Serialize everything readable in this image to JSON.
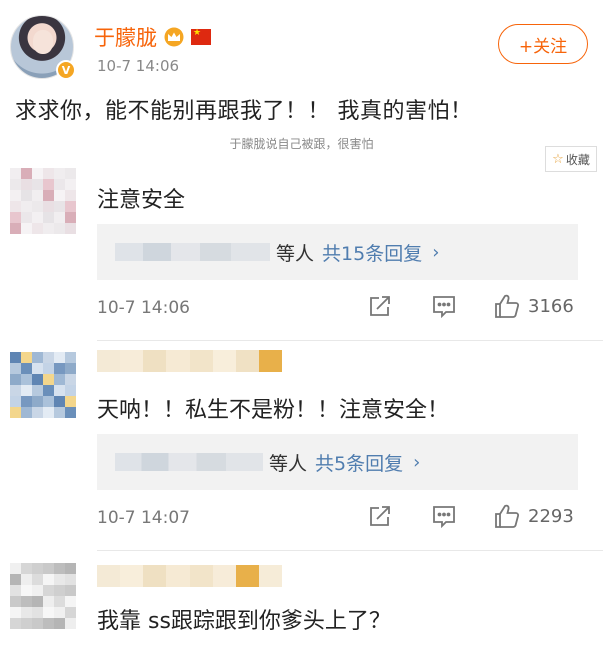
{
  "post": {
    "username": "于朦胧",
    "time": "10-7 14:06",
    "follow_label": "+关注",
    "text": "求求你，能不能别再跟我了！！ 我真的害怕！",
    "caption": "于朦胧说自己被跟，很害怕",
    "collect_label": "收藏"
  },
  "comments": [
    {
      "text": "注意安全",
      "reply_others": "等人",
      "reply_count": "共15条回复",
      "time": "10-7 14:06",
      "likes": "3166"
    },
    {
      "text": "天呐！！私生不是粉！！注意安全！",
      "reply_others": "等人",
      "reply_count": "共5条回复",
      "time": "10-7 14:07",
      "likes": "2293"
    },
    {
      "text": "我靠 ss跟踪跟到你爹头上了？"
    }
  ],
  "icons": {
    "share": "share-icon",
    "comment": "comment-icon",
    "like": "like-icon",
    "chevron": "chevron-right-icon",
    "verified": "verified-badge-icon",
    "crown": "crown-icon",
    "flag": "china-flag-icon",
    "star": "star-icon"
  },
  "colors": {
    "accent": "#f7640a",
    "link": "#507daf",
    "badge": "#f5a623"
  }
}
